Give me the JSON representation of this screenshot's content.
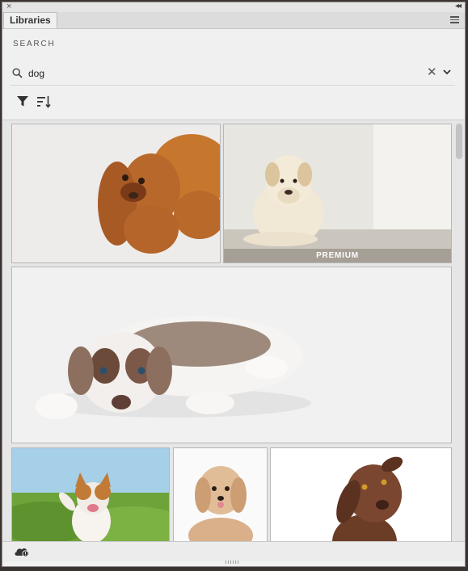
{
  "panel": {
    "tab_label": "Libraries",
    "close_glyph": "×",
    "collapse_glyph": "◂◂"
  },
  "search": {
    "heading": "SEARCH",
    "query": "dog",
    "clear_glyph": "✕"
  },
  "results": [
    {
      "name": "cocker spaniel puppy upside down",
      "premium": false
    },
    {
      "name": "yellow labrador lying on floor",
      "premium": true,
      "badge": "PREMIUM"
    },
    {
      "name": "merle australian shepherd puppy lying down",
      "premium": false
    },
    {
      "name": "jack russell terrier running on grass",
      "premium": false
    },
    {
      "name": "fluffy havanese puppy",
      "premium": false
    },
    {
      "name": "chocolate labrador tilting head",
      "premium": false
    }
  ],
  "icons": {
    "filter": "filter-icon",
    "sort": "sort-icon",
    "search": "search-icon",
    "menu": "hamburger-menu-icon",
    "cloud": "cloud-sync-icon"
  },
  "colors": {
    "panel_bg": "#f0f0f0",
    "text": "#333333"
  }
}
